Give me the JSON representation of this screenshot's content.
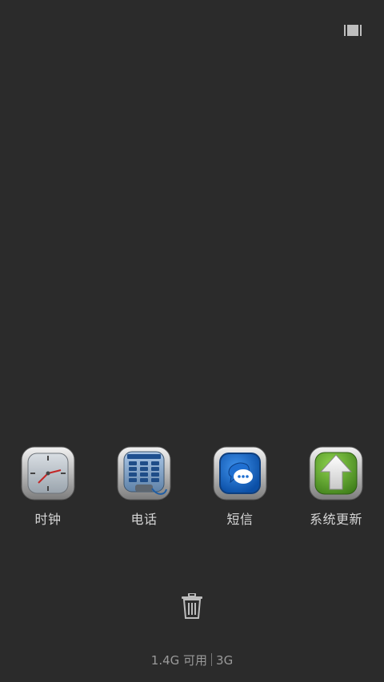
{
  "top_bar": {
    "recent_view_icon": "recent-view-toggle-icon"
  },
  "recent_apps": [
    {
      "label": "时钟",
      "icon": "clock-icon"
    },
    {
      "label": "电话",
      "icon": "phone-icon"
    },
    {
      "label": "短信",
      "icon": "messages-icon"
    },
    {
      "label": "系统更新",
      "icon": "system-update-icon"
    }
  ],
  "bottom": {
    "trash_icon": "trash-icon",
    "memory_text": "1.4G 可用",
    "memory_total": "3G"
  },
  "colors": {
    "background": "#2b2b2b",
    "label": "#d6d6d6",
    "memory_text": "#9a9a9a",
    "messages_blue": "#1f6fd1",
    "update_green": "#5aa32a"
  }
}
